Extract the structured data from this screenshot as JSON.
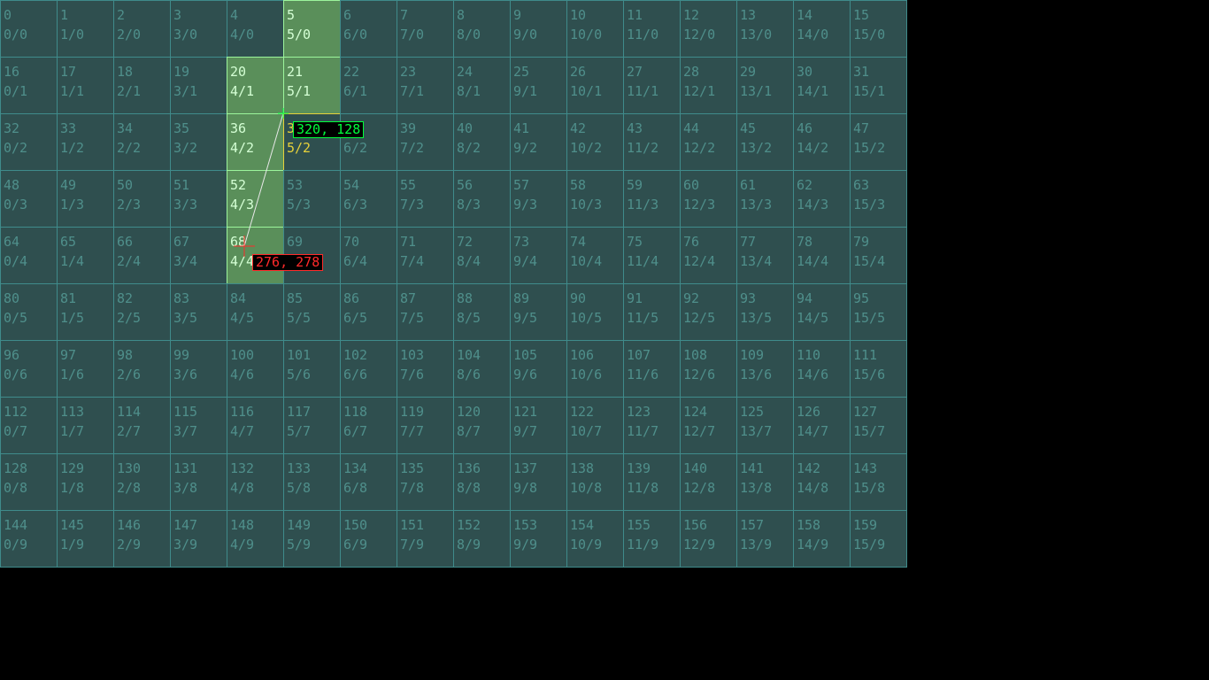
{
  "grid": {
    "columns": 16,
    "rows": 10,
    "highlighted_cells": [
      5,
      20,
      21,
      36,
      52,
      68
    ],
    "target_cell": 37
  },
  "pointer": {
    "start_label": "320, 128",
    "end_label": "276, 278"
  },
  "colors": {
    "background": "#000000",
    "cell_fill": "#2f4f4f",
    "cell_border": "#3f8b8b",
    "cell_text": "#4f8f8b",
    "highlight_fill": "#5a8f5a",
    "highlight_border": "#9cf59c",
    "highlight_text": "#d4ffd4",
    "target_color": "#e6d13a",
    "start_color": "#00ff3c",
    "end_color": "#ff2a2a",
    "path_color": "#e8e8e8"
  }
}
